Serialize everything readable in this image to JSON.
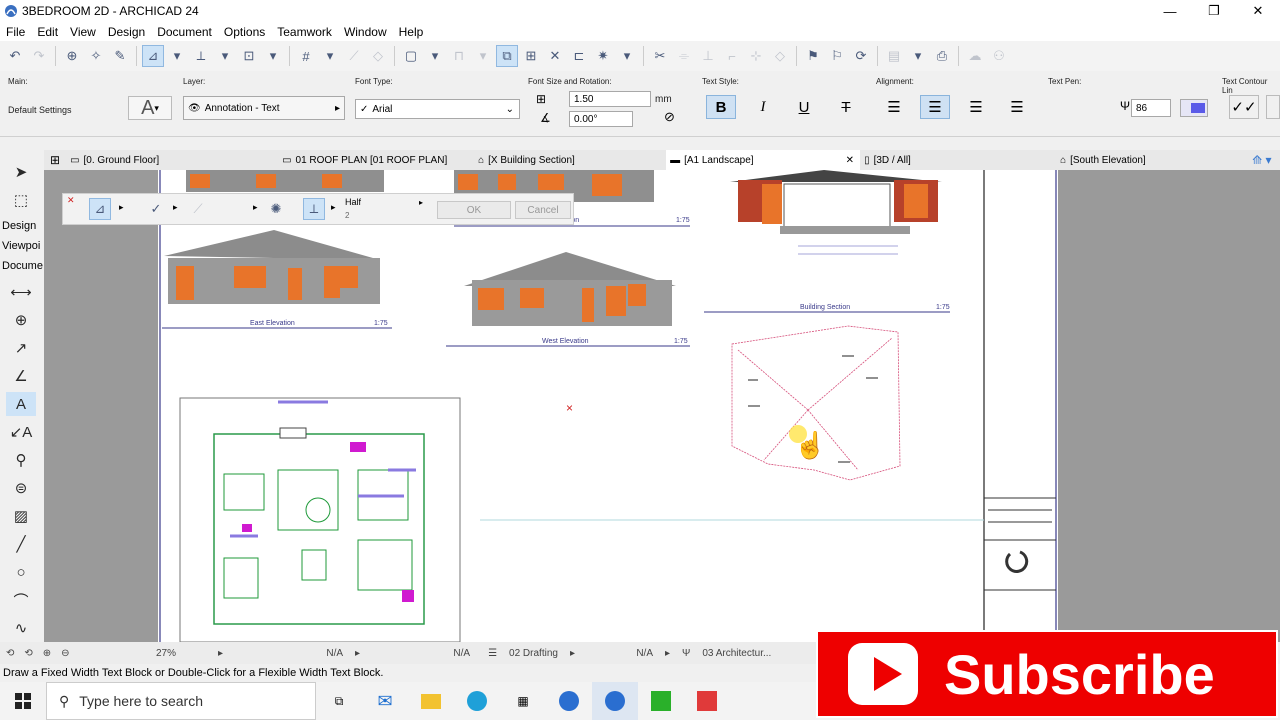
{
  "window": {
    "title": "3BEDROOM 2D - ARCHICAD 24",
    "minimize": "—",
    "restore": "❐",
    "close": "✕"
  },
  "menu": [
    "File",
    "Edit",
    "View",
    "Design",
    "Document",
    "Options",
    "Teamwork",
    "Window",
    "Help"
  ],
  "infobox": {
    "main_label": "Main:",
    "main_value": "Default Settings",
    "layer_label": "Layer:",
    "layer_value": "Annotation - Text",
    "font_type_label": "Font Type:",
    "font_value": "Arial",
    "font_size_label": "Font Size and Rotation:",
    "font_size": "1.50",
    "font_unit": "mm",
    "rotation": "0.00°",
    "text_style_label": "Text Style:",
    "style_bold": "B",
    "style_italic": "I",
    "style_underline": "U",
    "style_strike": "T",
    "alignment_label": "Alignment:",
    "text_pen_label": "Text Pen:",
    "text_pen_value": "86",
    "text_contour_label": "Text Contour Lin"
  },
  "tabs": [
    {
      "label": "[0. Ground Floor]",
      "icon": "floor-plan-icon"
    },
    {
      "label": "01 ROOF PLAN [01 ROOF PLAN]",
      "icon": "layout-icon"
    },
    {
      "label": "[X Building Section]",
      "icon": "section-icon"
    },
    {
      "label": "[A1 Landscape]",
      "icon": "layout-icon",
      "active": true
    },
    {
      "label": "[3D / All]",
      "icon": "3d-icon"
    },
    {
      "label": "[South Elevation]",
      "icon": "elevation-icon"
    }
  ],
  "tab_close": "✕",
  "toolbox": {
    "design": "Design",
    "viewpoint": "Viewpoi",
    "document": "Docume"
  },
  "pet_palette": {
    "half_label": "Half",
    "half_value": "2",
    "ok": "OK",
    "cancel": "Cancel"
  },
  "drawing_labels": {
    "east": "East Elevation",
    "east_scale": "1:75",
    "west": "West Elevation",
    "west_scale": "1:75",
    "section": "Building Section",
    "section_scale": "1:75",
    "top_scale": "1:75",
    "top_label": "ation"
  },
  "status": {
    "zoom": "27%",
    "na1": "N/A",
    "na2": "N/A",
    "na3": "N/A",
    "layer_combo": "02 Drafting",
    "pen_set": "03 Architectur..."
  },
  "hint": "Draw a Fixed Width Text Block or Double-Click for a Flexible Width Text Block.",
  "taskbar": {
    "search_placeholder": "Type here to search"
  },
  "overlay": {
    "subscribe": "Subscribe"
  },
  "colors": {
    "accent": "#cde3f7",
    "brand_red": "#ee0000",
    "plan_green": "#1f9a3a",
    "plan_magenta": "#d01ad0",
    "roof_grey": "#8c8c8c",
    "elevation_orange": "#e8742a"
  }
}
